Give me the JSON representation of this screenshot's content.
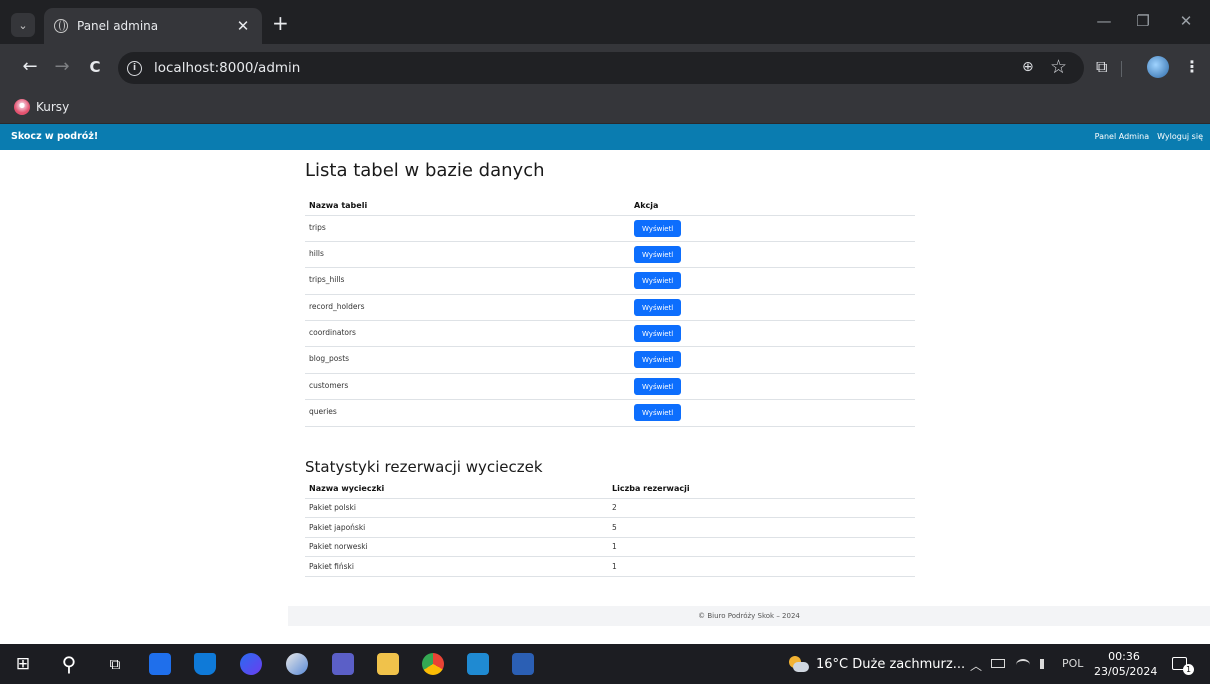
{
  "browser": {
    "tab_title": "Panel admina",
    "tab_close": "✕",
    "new_tab": "+",
    "tab_menu": "⌄",
    "url": "localhost:8000/admin",
    "info_icon": "i",
    "bookmark": "Kursy",
    "window_minimize": "—",
    "window_restore": "❐",
    "window_close": "✕",
    "nav_back": "←",
    "nav_forward": "→",
    "nav_reload": "C",
    "zoom_icon": "⊕",
    "star_icon": "☆",
    "extensions_icon": "⧉",
    "menu_icon": "⋮"
  },
  "site": {
    "brand": "Skocz w podróż!",
    "nav_links": [
      "Panel Admina",
      "Wyloguj się"
    ]
  },
  "tables_section": {
    "title": "Lista tabel w bazie danych",
    "header_name": "Nazwa tabeli",
    "header_action": "Akcja",
    "rows": [
      {
        "name": "trips",
        "action": "Wyświetl"
      },
      {
        "name": "hills",
        "action": "Wyświetl"
      },
      {
        "name": "trips_hills",
        "action": "Wyświetl"
      },
      {
        "name": "record_holders",
        "action": "Wyświetl"
      },
      {
        "name": "coordinators",
        "action": "Wyświetl"
      },
      {
        "name": "blog_posts",
        "action": "Wyświetl"
      },
      {
        "name": "customers",
        "action": "Wyświetl"
      },
      {
        "name": "queries",
        "action": "Wyświetl"
      }
    ]
  },
  "stats_section": {
    "title": "Statystyki rezerwacji wycieczek",
    "header_name": "Nazwa wycieczki",
    "header_count": "Liczba rezerwacji",
    "rows": [
      {
        "name": "Pakiet polski",
        "count": "2"
      },
      {
        "name": "Pakiet japoński",
        "count": "5"
      },
      {
        "name": "Pakiet norweski",
        "count": "1"
      },
      {
        "name": "Pakiet fiński",
        "count": "1"
      }
    ]
  },
  "footer": "© Biuro Podróży Skok – 2024",
  "taskbar": {
    "weather": "16°C  Duże zachmurz...",
    "language": "POL",
    "time": "00:36",
    "date": "23/05/2024",
    "notification_count": "1",
    "tray_chevron": "︿",
    "search_glyph": "⚲",
    "start_glyph": "⊞",
    "taskview_glyph": "⧉"
  },
  "colors": {
    "site_nav": "#0a7cb0",
    "button": "#0d6efd",
    "chrome_dark": "#202124",
    "chrome_toolbar": "#35363a",
    "taskbar": "#1c1d22"
  }
}
